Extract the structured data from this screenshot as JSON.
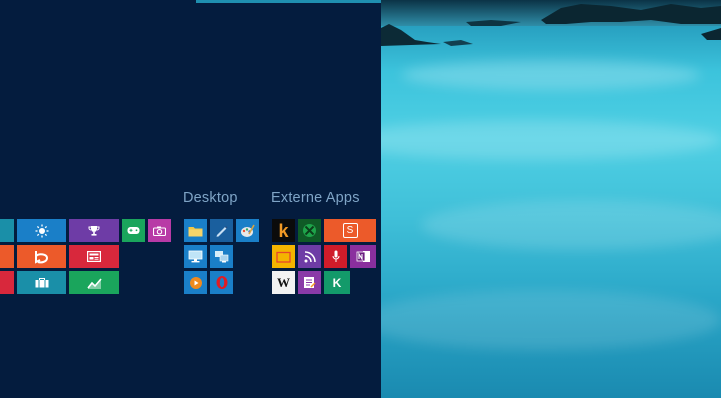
{
  "groups": {
    "desktop_label": "Desktop",
    "apps_label": "Externe Apps"
  },
  "tiles": {
    "s_label": "S",
    "k_label": "k",
    "w_label": "W",
    "kk_label": "K"
  },
  "colors": {
    "start_background": "#041c3e",
    "accent": "#1f8fb0",
    "tile_blue": "#1a7fc8",
    "tile_orange": "#ec5a2a",
    "tile_purple": "#6e3ca6",
    "tile_green": "#1aa55c",
    "tile_red": "#d8283c",
    "tile_magenta": "#b83aa6",
    "tile_teal": "#1a8fa8"
  },
  "icons": [
    "weather-sun-icon",
    "trophy-icon",
    "games-controller-icon",
    "camera-icon",
    "bing-icon",
    "news-icon",
    "travel-icon",
    "finance-chart-icon",
    "file-explorer-icon",
    "pen-icon",
    "paint-icon",
    "remote-desktop-icon",
    "network-icon",
    "media-player-icon",
    "opera-icon",
    "kindle-icon",
    "xbox-icon",
    "skype-icon",
    "folder-icon",
    "rss-icon",
    "microphone-icon",
    "onenote-icon",
    "wikipedia-icon",
    "notes-icon",
    "kobo-icon"
  ]
}
